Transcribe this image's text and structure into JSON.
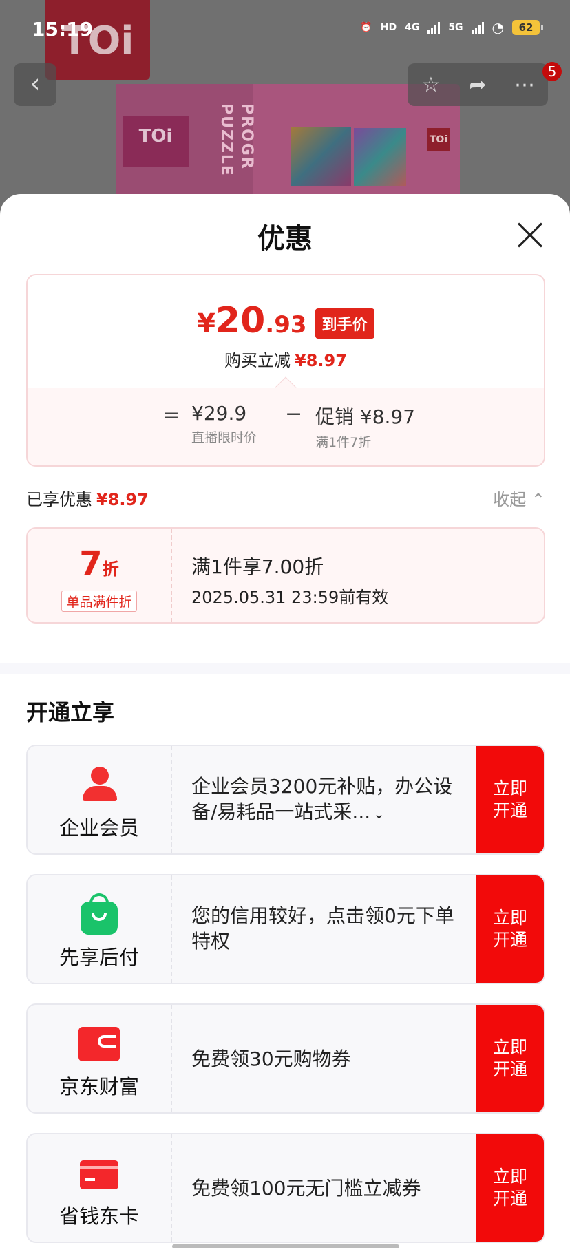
{
  "status_bar": {
    "time": "15:19",
    "network_1": "HD",
    "network_2": "4G",
    "network_3": "5G",
    "battery": "62"
  },
  "nav": {
    "back_icon": "chevron-left-icon",
    "badge": "5"
  },
  "background": {
    "logo_text": "TOi",
    "box_logo": "TOi",
    "box_text_1": "PROGR",
    "box_text_2": "PUZZLE"
  },
  "sheet": {
    "title": "优惠",
    "price": {
      "yen": "¥",
      "int": "20",
      "dec": ".93",
      "tag": "到手价",
      "reduce_label": "购买立减",
      "reduce_value": "¥8.97"
    },
    "formula": {
      "eq": "=",
      "item1_value": "¥29.9",
      "item1_sub": "直播限时价",
      "minus": "−",
      "item2_value": "促销 ¥8.97",
      "item2_sub": "满1件7折"
    },
    "enjoyed": {
      "label": "已享优惠",
      "value": "¥8.97",
      "collapse": "收起 ⌃"
    },
    "discount_card": {
      "big": "7",
      "big_unit": "折",
      "tag": "单品满件折",
      "line1": "满1件享7.00折",
      "line2": "2025.05.31 23:59前有效"
    },
    "open_title": "开通立享",
    "services": [
      {
        "name": "企业会员",
        "icon": "person-icon",
        "desc": "企业会员3200元补贴，办公设备/易耗品一站式采...",
        "button": "立即开通"
      },
      {
        "name": "先享后付",
        "icon": "shopping-bag-icon",
        "desc": "您的信用较好，点击领0元下单特权",
        "button": "立即开通"
      },
      {
        "name": "京东财富",
        "icon": "wallet-icon",
        "desc": "免费领30元购物券",
        "button": "立即开通"
      },
      {
        "name": "省钱东卡",
        "icon": "card-icon",
        "desc": "免费领100元无门槛立减券",
        "button": "立即开通"
      }
    ]
  },
  "colors": {
    "accent_red": "#e1251b",
    "button_red": "#f20a0a",
    "green": "#1ac36a"
  }
}
